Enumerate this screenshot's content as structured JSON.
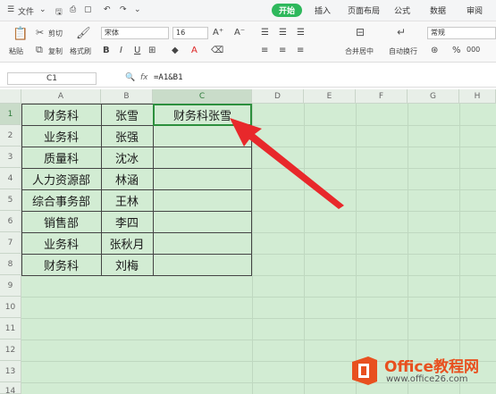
{
  "titlebar": {
    "menu_label": "文件",
    "tabs": [
      "开始",
      "插入",
      "页面布局",
      "公式",
      "数据",
      "审阅"
    ]
  },
  "ribbon": {
    "cut": "剪切",
    "paste": "粘贴",
    "copy": "复制",
    "format_painter": "格式刷",
    "font_name": "宋体",
    "font_size": "16",
    "merge_center": "合并居中",
    "auto_wrap": "自动换行",
    "number_format": "常规"
  },
  "formula_bar": {
    "name_box": "C1",
    "fx_label": "fx",
    "formula": "=A1&B1"
  },
  "columns": [
    "A",
    "B",
    "C",
    "D",
    "E",
    "F",
    "G",
    "H"
  ],
  "rows": [
    "1",
    "2",
    "3",
    "4",
    "5",
    "6",
    "7",
    "8",
    "9",
    "10",
    "11",
    "12",
    "13",
    "14"
  ],
  "table": {
    "col_a": [
      "财务科",
      "业务科",
      "质量科",
      "人力资源部",
      "综合事务部",
      "销售部",
      "业务科",
      "财务科"
    ],
    "col_b": [
      "张雪",
      "张强",
      "沈冰",
      "林涵",
      "王林",
      "李四",
      "张秋月",
      "刘梅"
    ],
    "c1_result": "财务科张雪"
  },
  "logo": {
    "brand": "Office教程网",
    "url": "www.office26.com"
  },
  "colors": {
    "accent": "#2eb85c",
    "sheet_bg": "#d2ecd3",
    "arrow": "#e8282b",
    "logo_orange": "#e8501f"
  }
}
